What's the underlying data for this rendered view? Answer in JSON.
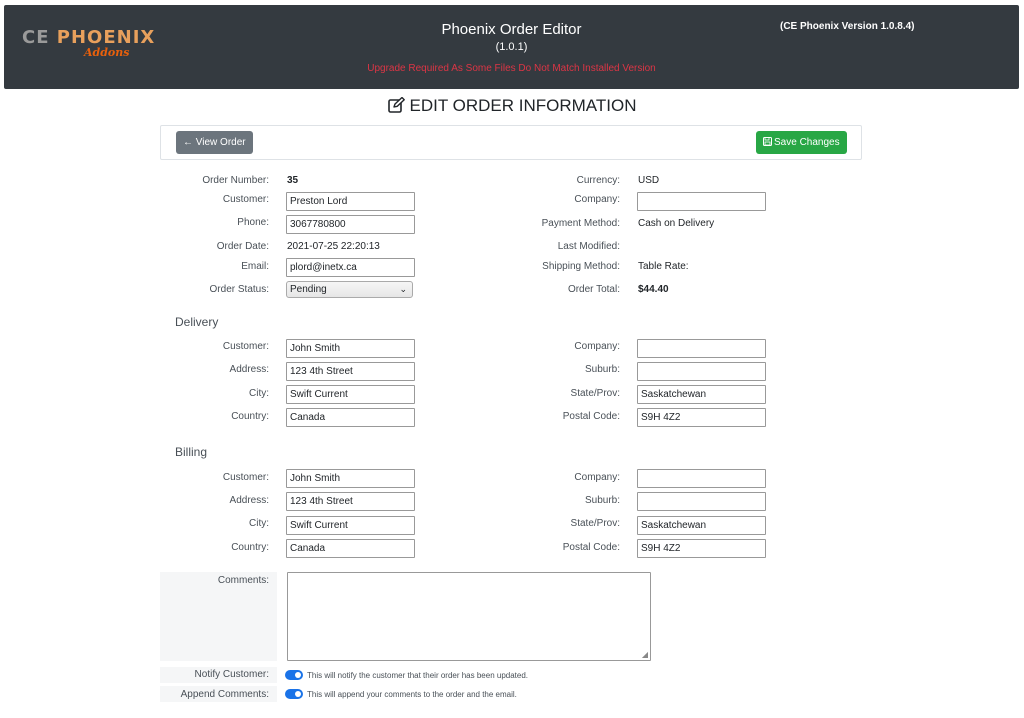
{
  "header": {
    "logo": {
      "word1": "CE ",
      "word2": "PHOENIX",
      "sub": "Addons"
    },
    "title": "Phoenix Order Editor",
    "version": "(1.0.1)",
    "warning": "Upgrade Required As Some Files Do Not Match Installed Version",
    "ce_version": "(CE Phoenix Version 1.0.8.4)",
    "colors": {
      "bar": "#343a40",
      "warning": "#dc3545"
    }
  },
  "page_title": "EDIT ORDER INFORMATION",
  "toolbar": {
    "view_label": "View Order",
    "save_label": "Save Changes",
    "colors": {
      "view": "#6c757d",
      "save": "#28a745"
    }
  },
  "order": {
    "number_label": "Order Number:",
    "number": "35",
    "customer_label": "Customer:",
    "customer": "Preston Lord",
    "phone_label": "Phone:",
    "phone": "3067780800",
    "date_label": "Order Date:",
    "date": "2021-07-25 22:20:13",
    "email_label": "Email:",
    "email": "plord@inetx.ca",
    "status_label": "Order Status:",
    "status": "Pending",
    "currency_label": "Currency:",
    "currency": "USD",
    "company_label": "Company:",
    "company": "",
    "payment_label": "Payment Method:",
    "payment": "Cash on Delivery",
    "modified_label": "Last Modified:",
    "modified": "",
    "shipping_label": "Shipping Method:",
    "shipping": "Table Rate:",
    "total_label": "Order Total:",
    "total": "$44.40"
  },
  "delivery": {
    "heading": "Delivery",
    "customer_label": "Customer:",
    "customer": "John Smith",
    "address_label": "Address:",
    "address": "123 4th Street",
    "city_label": "City:",
    "city": "Swift Current",
    "country_label": "Country:",
    "country": "Canada",
    "company_label": "Company:",
    "company": "",
    "suburb_label": "Suburb:",
    "suburb": "",
    "state_label": "State/Prov:",
    "state": "Saskatchewan",
    "postal_label": "Postal Code:",
    "postal": "S9H 4Z2"
  },
  "billing": {
    "heading": "Billing",
    "customer_label": "Customer:",
    "customer": "John Smith",
    "address_label": "Address:",
    "address": "123 4th Street",
    "city_label": "City:",
    "city": "Swift Current",
    "country_label": "Country:",
    "country": "Canada",
    "company_label": "Company:",
    "company": "",
    "suburb_label": "Suburb:",
    "suburb": "",
    "state_label": "State/Prov:",
    "state": "Saskatchewan",
    "postal_label": "Postal Code:",
    "postal": "S9H 4Z2"
  },
  "comments": {
    "label": "Comments:",
    "value": "",
    "notify_label": "Notify Customer:",
    "notify_hint": "This will notify the customer that their order has been updated.",
    "append_label": "Append Comments:",
    "append_hint": "This will append your comments to the order and the email.",
    "toggle_color": "#1a73e8"
  }
}
